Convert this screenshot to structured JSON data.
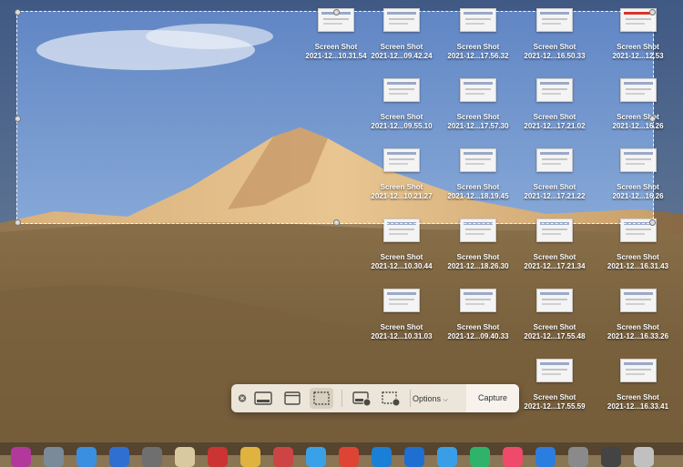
{
  "files": [
    {
      "name": "Screen Shot",
      "date": "2021-12...10.31.54",
      "accent": false
    },
    {
      "name": "Screen Shot",
      "date": "2021-12...09.42.24",
      "accent": false
    },
    {
      "name": "Screen Shot",
      "date": "2021-12...17.56.32",
      "accent": false
    },
    {
      "name": "Screen Shot",
      "date": "2021-12...16.50.33",
      "accent": false
    },
    {
      "name": "Screen Shot",
      "date": "2021-12...12.53",
      "accent": true
    },
    {
      "name": "Screen Shot",
      "date": "2021-12...09.55.10",
      "accent": false
    },
    {
      "name": "Screen Shot",
      "date": "2021-12...17.57.30",
      "accent": false
    },
    {
      "name": "Screen Shot",
      "date": "2021-12...17.21.02",
      "accent": false
    },
    {
      "name": "Screen Shot",
      "date": "2021-12...16.26",
      "accent": false
    },
    {
      "name": "Screen Shot",
      "date": "2021-12...10.21.27",
      "accent": false
    },
    {
      "name": "Screen Shot",
      "date": "2021-12...18.19.45",
      "accent": false
    },
    {
      "name": "Screen Shot",
      "date": "2021-12...17.21.22",
      "accent": false
    },
    {
      "name": "Screen Shot",
      "date": "2021-12...16.26",
      "accent": false
    },
    {
      "name": "Screen Shot",
      "date": "2021-12...10.30.44",
      "accent": false
    },
    {
      "name": "Screen Shot",
      "date": "2021-12...18.26.30",
      "accent": false
    },
    {
      "name": "Screen Shot",
      "date": "2021-12...17.21.34",
      "accent": false
    },
    {
      "name": "Screen Shot",
      "date": "2021-12...16.31.43",
      "accent": false
    },
    {
      "name": "Screen Shot",
      "date": "2021-12...10.31.03",
      "accent": false
    },
    {
      "name": "Screen Shot",
      "date": "2021-12...09.40.33",
      "accent": false
    },
    {
      "name": "Screen Shot",
      "date": "2021-12...17.55.48",
      "accent": false
    },
    {
      "name": "Screen Shot",
      "date": "2021-12...16.33.26",
      "accent": false
    },
    {
      "name": "Screen Shot",
      "date": "2021-12...17.55.59",
      "accent": false
    },
    {
      "name": "Screen Shot",
      "date": "2021-12...16.33.41",
      "accent": false
    }
  ],
  "toolbar": {
    "options_label": "Options",
    "capture_label": "Capture",
    "icons": [
      "close-icon",
      "capture-screen-icon",
      "capture-window-icon",
      "capture-selection-icon",
      "record-screen-icon",
      "record-selection-icon"
    ]
  },
  "colors": {
    "toolbar_bg": "#ece5d9",
    "selected_tool": "#d8cfc0",
    "accent_thumb": "#d9342b"
  }
}
